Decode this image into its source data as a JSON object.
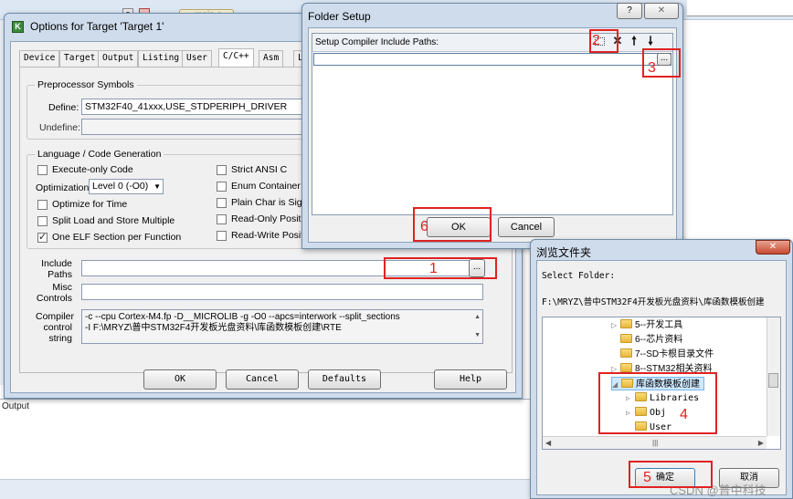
{
  "ide": {
    "tab_label": "main.c",
    "output_label": "Output"
  },
  "options": {
    "title": "Options for Target 'Target 1'",
    "tabs": [
      "Device",
      "Target",
      "Output",
      "Listing",
      "User",
      "C/C++",
      "Asm",
      "L"
    ],
    "active_tab": "C/C++",
    "preprocessor": {
      "caption": "Preprocessor Symbols",
      "define_label": "Define:",
      "define_value": "STM32F40_41xxx,USE_STDPERIPH_DRIVER",
      "undefine_label": "Undefine:",
      "undefine_value": ""
    },
    "language": {
      "caption": "Language / Code Generation",
      "execute_only": "Execute-only Code",
      "optimization_label": "Optimization:",
      "optimization_value": "Level 0 (-O0)",
      "optimize_time": "Optimize for Time",
      "split_load": "Split Load and Store Multiple",
      "one_elf": "One ELF Section per Function",
      "strict_ansi": "Strict ANSI C",
      "enum_container": "Enum Container alw",
      "plain_char": "Plain Char is Signe",
      "readonly_pos": "Read-Only Position",
      "readwrite_pos": "Read-Write Position"
    },
    "include_paths_label": "Include\nPaths",
    "include_paths_value": "",
    "misc_controls_label": "Misc\nControls",
    "misc_controls_value": "",
    "compiler_label": "Compiler\ncontrol\nstring",
    "compiler_line1": "-c --cpu Cortex-M4.fp -D__MICROLIB -g -O0 --apcs=interwork --split_sections",
    "compiler_line2": "-I F:\\MRYZ\\普中STM32F4开发板光盘资料\\库函数模板创建\\RTE",
    "buttons": {
      "ok": "OK",
      "cancel": "Cancel",
      "defaults": "Defaults",
      "help": "Help"
    },
    "browse_btn": "..."
  },
  "folder_setup": {
    "title": "Folder Setup",
    "help_btn": "?",
    "close_btn": "✕",
    "list_header": "Setup Compiler Include Paths:",
    "list_value": "",
    "browse_btn": "...",
    "ok": "OK",
    "cancel": "Cancel"
  },
  "browse_folder": {
    "title": "浏览文件夹",
    "close_btn": "✕",
    "select_label": "Select Folder:",
    "path": "F:\\MRYZ\\普中STM32F4开发板光盘资料\\库函数模板创建",
    "tree": [
      {
        "label": "5--开发工具",
        "expander": "▷"
      },
      {
        "label": "6--芯片资料",
        "expander": ""
      },
      {
        "label": "7--SD卡根目录文件",
        "expander": ""
      },
      {
        "label": "8--STM32相关资料",
        "expander": "▷"
      },
      {
        "label": "库函数模板创建",
        "expander": "◢"
      },
      {
        "label": "Libraries",
        "expander": "▷"
      },
      {
        "label": "Obj",
        "expander": "▷"
      },
      {
        "label": "User",
        "expander": ""
      }
    ],
    "ok": "确定",
    "cancel": "取消",
    "watermark": "CSDN @普中科技"
  },
  "annotations": [
    "1",
    "2",
    "3",
    "4",
    "5",
    "6"
  ],
  "colors": {
    "annotation": "#e02222",
    "window_frame": "#cfdcec",
    "dialog_body": "#f0f0f0"
  }
}
